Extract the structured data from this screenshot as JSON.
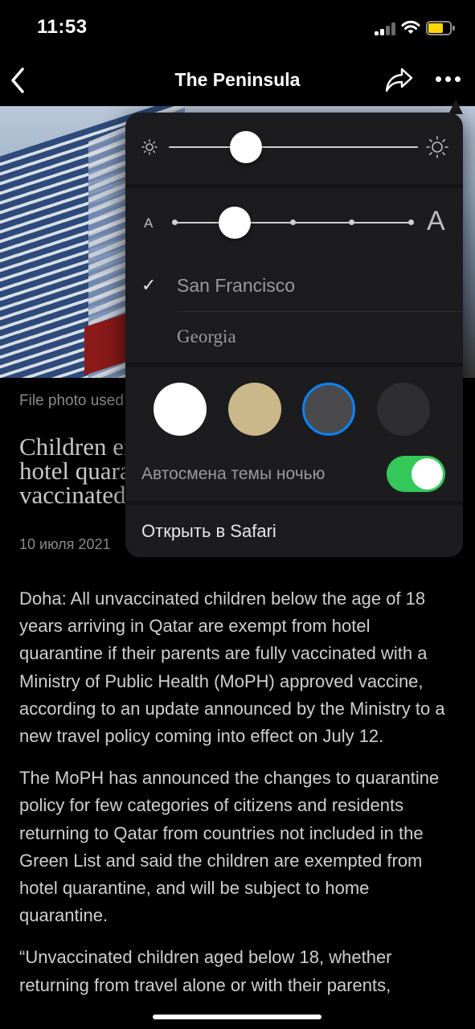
{
  "status": {
    "time": "11:53"
  },
  "nav": {
    "title": "The Peninsula"
  },
  "article": {
    "caption": "File photo used",
    "headline_lines": [
      "Children exempt from",
      "hotel quarantine if",
      "vaccinated parents"
    ],
    "date": "10 июля 2021",
    "paragraphs": [
      "Doha: All unvaccinated children below the age of 18 years arriving in Qatar are exempt from hotel quarantine if their parents are fully vaccinated with a Ministry of Public Health (MoPH) approved vaccine, according to an  update announced by the Ministry  to a new travel policy coming into effect on July 12.",
      "The MoPH has announced the changes to quarantine policy for few categories of citizens and residents returning to Qatar from countries not included in the Green List and said the children are exempted from hotel quarantine, and will be subject to home quarantine.",
      "“Unvaccinated children aged below 18, whether returning from travel alone or with their parents,"
    ]
  },
  "menu": {
    "brightness": {
      "level": 0.31,
      "min_icon": "sun-small-icon",
      "max_icon": "sun-large-icon"
    },
    "text_size": {
      "small_label": "A",
      "large_label": "A",
      "steps": 5,
      "selected_step": 1
    },
    "fonts": [
      {
        "label": "San Francisco",
        "selected": true
      },
      {
        "label": "Georgia",
        "selected": false
      }
    ],
    "themes": [
      {
        "name": "white",
        "color": "#ffffff",
        "selected": false
      },
      {
        "name": "sepia",
        "color": "#cbb88a",
        "selected": false
      },
      {
        "name": "gray",
        "color": "#4a4a4c",
        "selected": true
      },
      {
        "name": "dark",
        "color": "#2e2e30",
        "selected": false
      }
    ],
    "auto_theme_label": "Автосмена темы ночью",
    "auto_theme_on": true,
    "open_safari_label": "Открыть в Safari",
    "accent": "#0a84ff",
    "toggle_color": "#34c759"
  }
}
